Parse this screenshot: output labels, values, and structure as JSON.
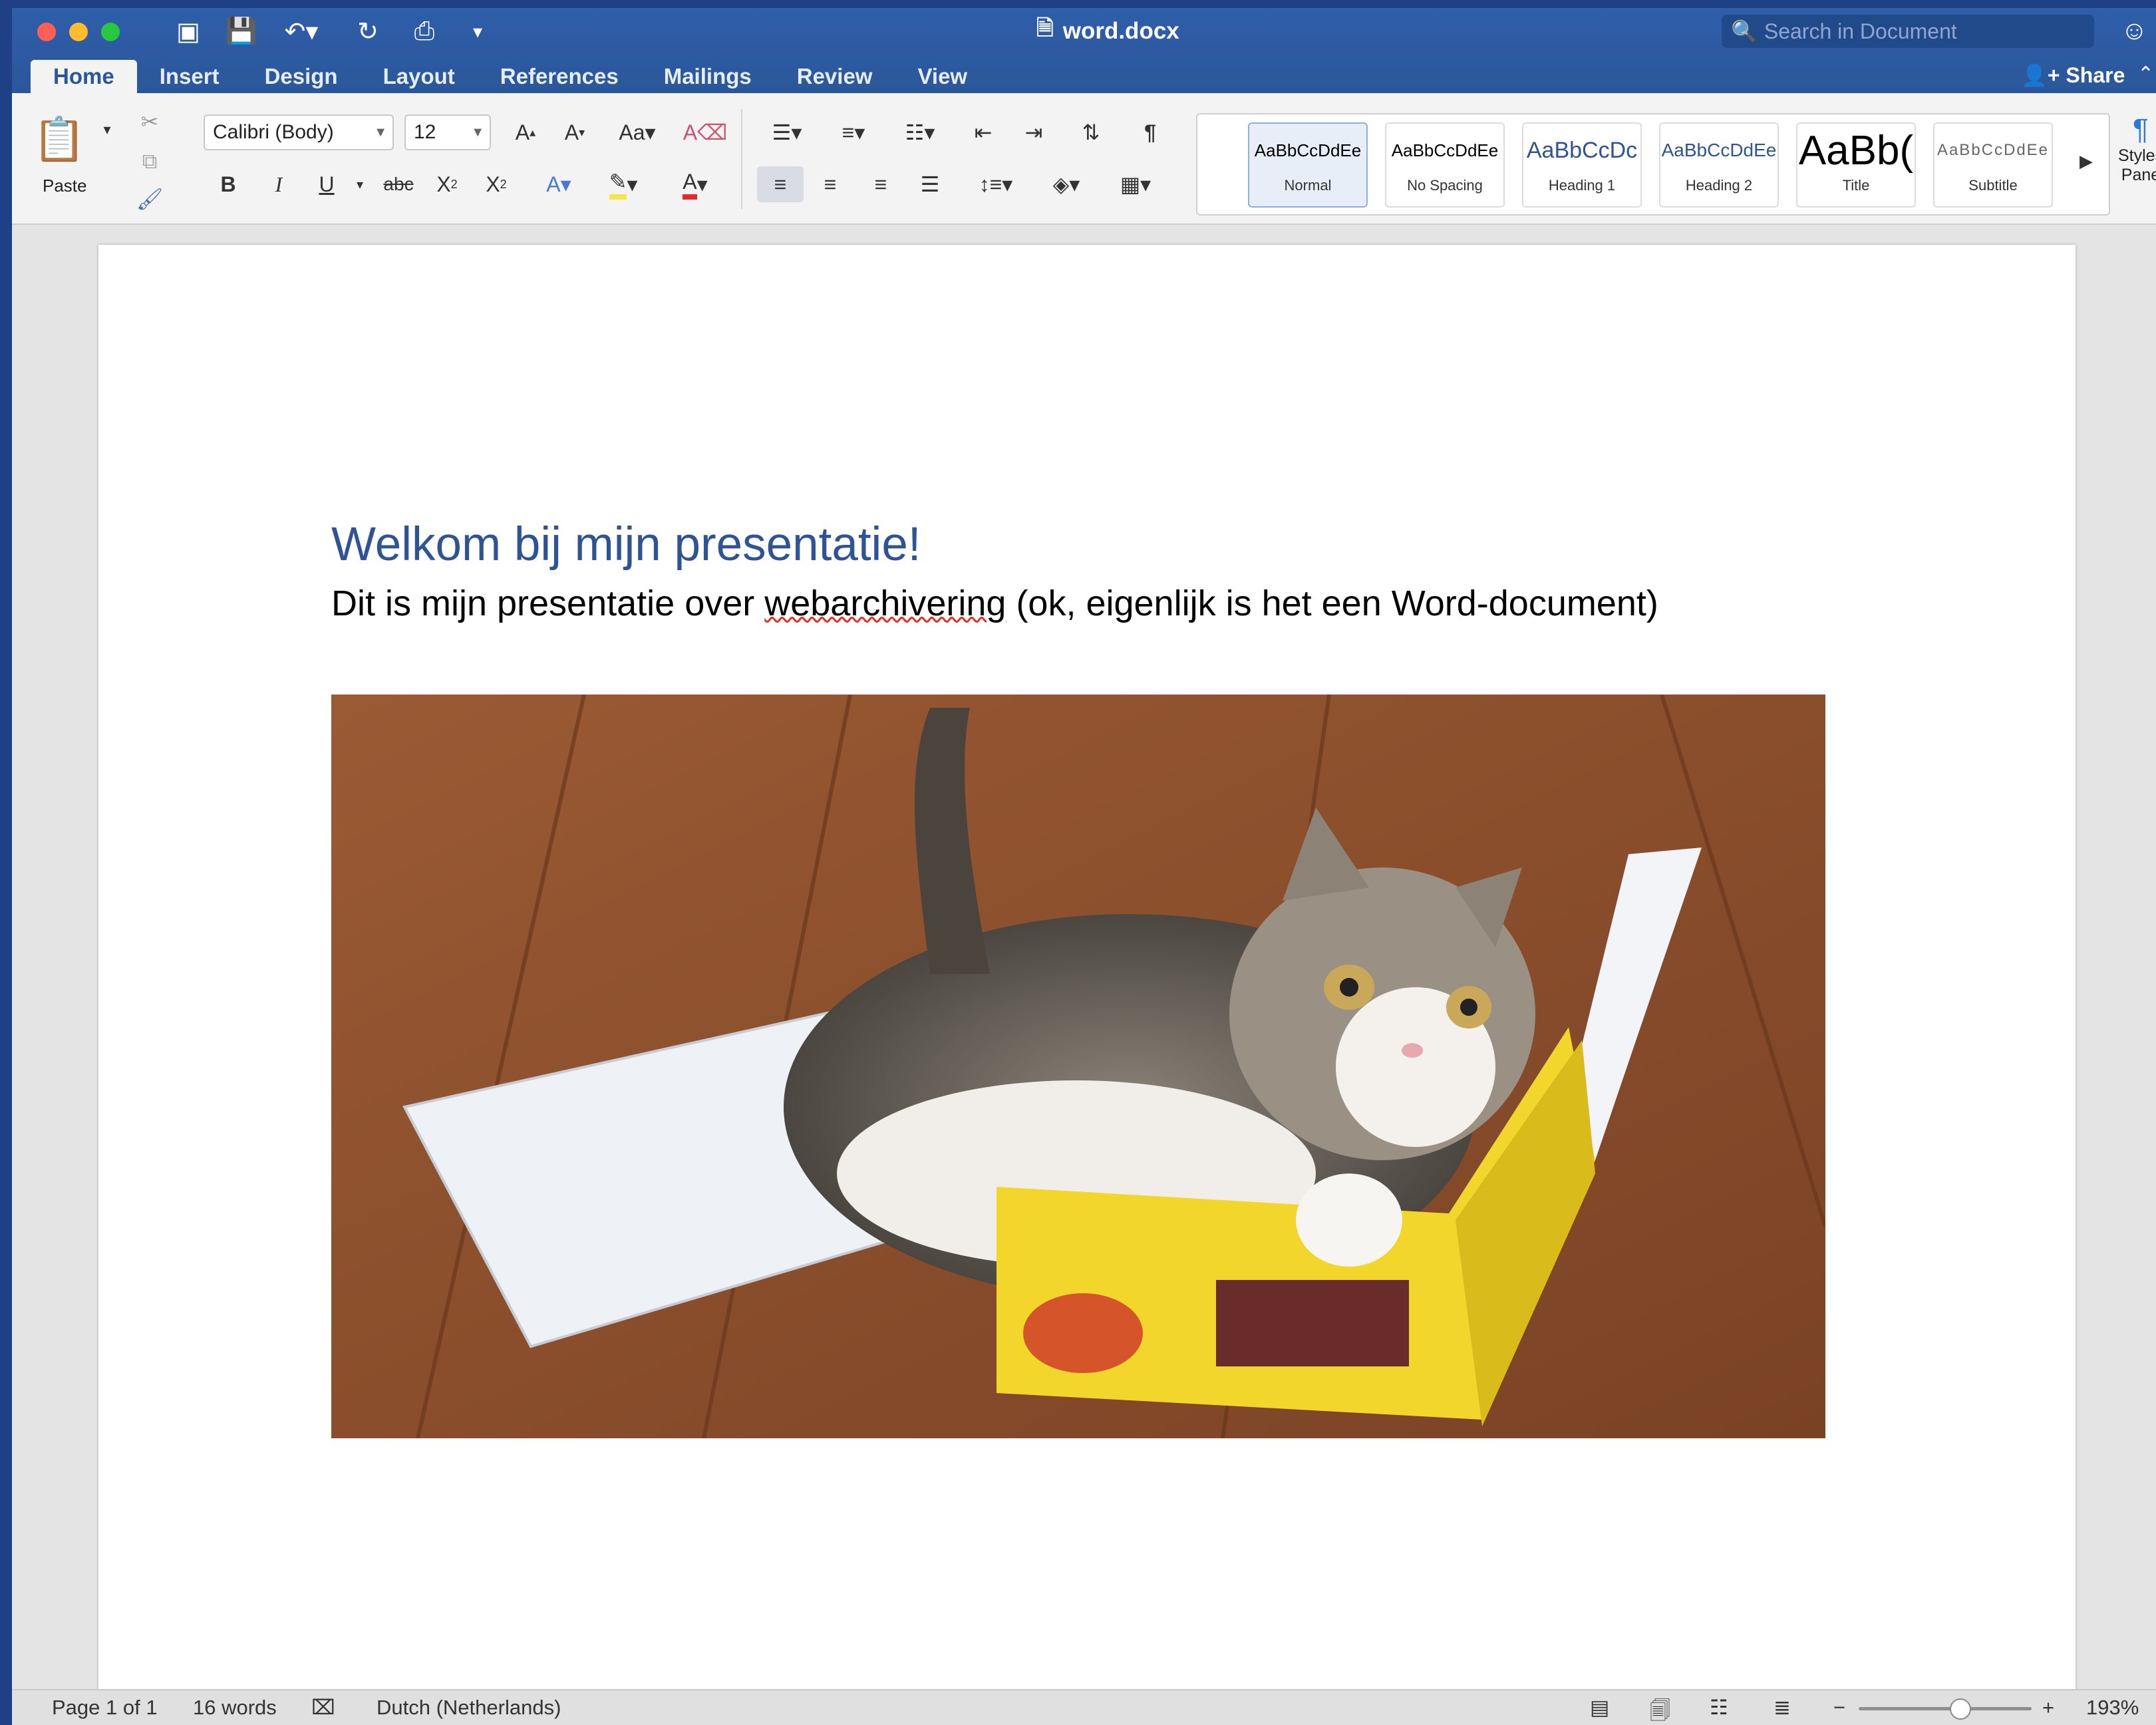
{
  "window": {
    "doc_title": "word.docx",
    "search_placeholder": "Search in Document",
    "share_label": "Share"
  },
  "tabs": [
    "Home",
    "Insert",
    "Design",
    "Layout",
    "References",
    "Mailings",
    "Review",
    "View"
  ],
  "ribbon": {
    "paste_label": "Paste",
    "font_name": "Calibri (Body)",
    "font_size": "12",
    "styles": [
      {
        "sample": "AaBbCcDdEe",
        "name": "Normal"
      },
      {
        "sample": "AaBbCcDdEe",
        "name": "No Spacing"
      },
      {
        "sample": "AaBbCcDc",
        "name": "Heading 1"
      },
      {
        "sample": "AaBbCcDdEe",
        "name": "Heading 2"
      },
      {
        "sample": "AaBb(",
        "name": "Title"
      },
      {
        "sample": "AaBbCcDdEe",
        "name": "Subtitle"
      }
    ],
    "styles_pane_label_1": "Styles",
    "styles_pane_label_2": "Pane"
  },
  "document": {
    "heading": "Welkom bij mijn presentatie!",
    "body_before": "Dit is mijn presentatie over ",
    "body_misspelled": "webarchivering",
    "body_after": " (ok, eigenlijk is het een Word-document)",
    "image_description_icon": "cat-in-box-photo"
  },
  "status": {
    "page": "Page 1 of 1",
    "words": "16 words",
    "language": "Dutch (Netherlands)",
    "zoom": "193%",
    "zoom_level_fraction": 0.58
  },
  "colors": {
    "title_bar": "#2b579a",
    "heading": "#2f5496",
    "accent": "#2b579a"
  }
}
